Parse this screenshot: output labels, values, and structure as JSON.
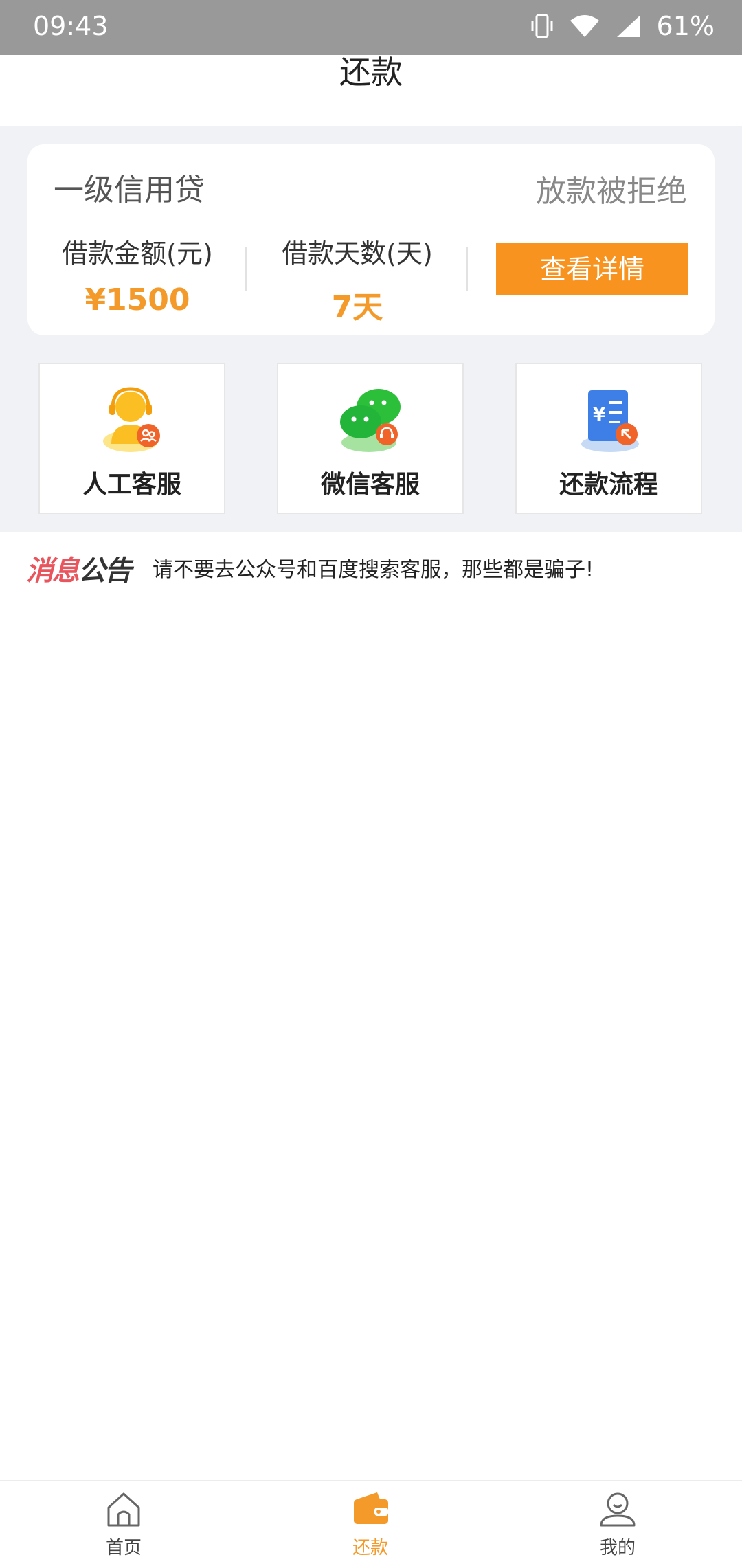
{
  "status_bar": {
    "time": "09:43",
    "battery": "61%"
  },
  "header": {
    "title": "还款"
  },
  "loan_card": {
    "product_name": "一级信用贷",
    "status": "放款被拒绝",
    "amount_label": "借款金额(元)",
    "amount_value": "¥1500",
    "days_label": "借款天数(天)",
    "days_value": "7天",
    "detail_button": "查看详情"
  },
  "services": [
    {
      "label": "人工客服",
      "icon": "customer-service-icon"
    },
    {
      "label": "微信客服",
      "icon": "wechat-icon"
    },
    {
      "label": "还款流程",
      "icon": "repayment-flow-icon"
    }
  ],
  "notice": {
    "logo_part1": "消息",
    "logo_part2": "公告",
    "text": "请不要去公众号和百度搜索客服，那些都是骗子!"
  },
  "tab_bar": [
    {
      "label": "首页",
      "icon": "home-icon",
      "active": false
    },
    {
      "label": "还款",
      "icon": "wallet-icon",
      "active": true
    },
    {
      "label": "我的",
      "icon": "user-icon",
      "active": false
    }
  ],
  "colors": {
    "accent": "#f7931e",
    "value": "#f39a2a",
    "status_bar": "#999999",
    "background": "#f0f2f5"
  }
}
